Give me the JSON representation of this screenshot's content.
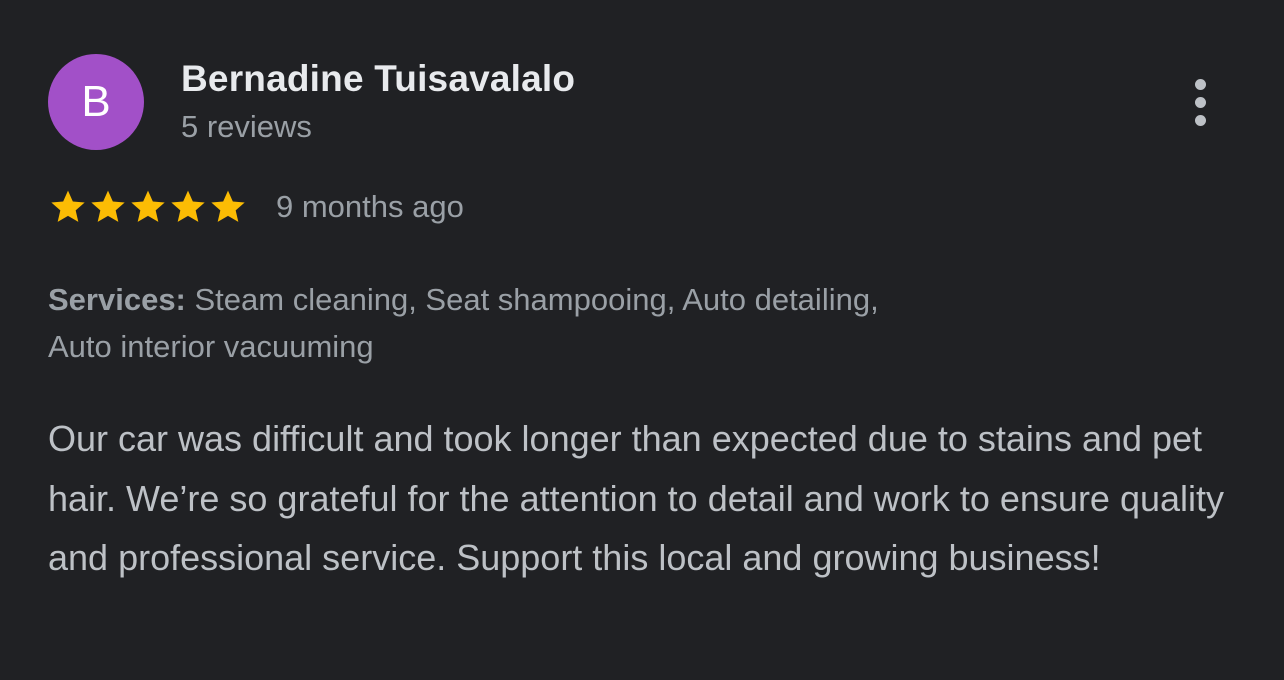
{
  "review": {
    "avatar_letter": "B",
    "avatar_color": "#a250c8",
    "reviewer_name": "Bernadine Tuisavalalo",
    "review_count": "5 reviews",
    "rating": 5,
    "rating_max": 5,
    "star_color": "#fbbc04",
    "time_ago": "9 months ago",
    "services_label": "Services:",
    "services_text": " Steam cleaning, Seat shampooing, Auto detailing,",
    "services_text_line2": "Auto interior vacuuming",
    "body": "Our car was difficult and took longer than expected due to stains and pet hair. We’re so grateful for the attention to detail and work to ensure quality and professional service. Support this local and growing business!",
    "more_icon": "more-vert-icon"
  }
}
